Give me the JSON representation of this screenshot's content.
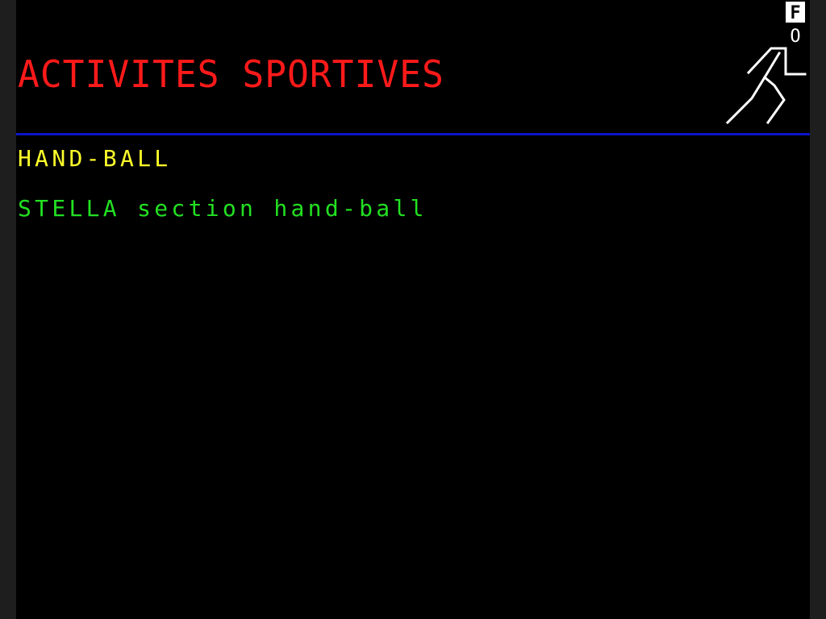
{
  "page": {
    "title": "ACTIVITES SPORTIVES",
    "heading": "HAND-BALL",
    "entries": [
      {
        "text": "STELLA section hand-ball"
      }
    ]
  },
  "logo": {
    "icon": "running-man-icon",
    "letter_top": "F",
    "letter_bottom": "O"
  },
  "colors": {
    "background": "#000000",
    "title": "#ff1a1a",
    "heading": "#ffff2a",
    "entry": "#22e022",
    "divider": "#0a14c8",
    "logo": "#ffffff"
  }
}
